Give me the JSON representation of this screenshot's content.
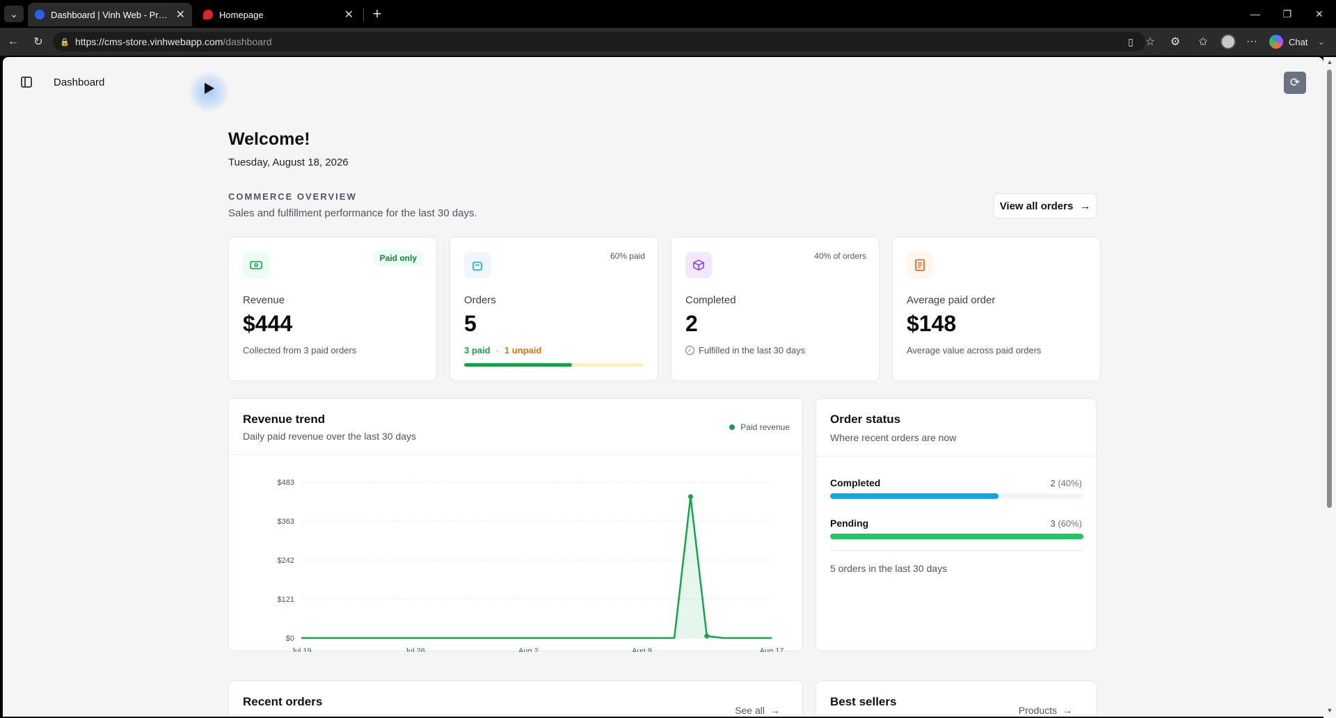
{
  "browser": {
    "tabs": [
      {
        "title": "Dashboard | Vinh Web - Professional",
        "active": true,
        "favicon_color": "#2563eb"
      },
      {
        "title": "Homepage",
        "active": false,
        "favicon_color": "#dc2626"
      }
    ],
    "url_host": "https://cms-store.vinhwebapp.com",
    "url_path": "/dashboard",
    "chat_label": "Chat"
  },
  "header": {
    "breadcrumb": "Dashboard"
  },
  "welcome": {
    "title": "Welcome!",
    "date": "Tuesday, August 18, 2026"
  },
  "overview": {
    "overline": "COMMERCE OVERVIEW",
    "description": "Sales and fulfillment performance for the last 30 days.",
    "view_all_label": "View all orders"
  },
  "kpis": {
    "revenue": {
      "label": "Revenue",
      "value": "$444",
      "badge": "Paid only",
      "sub": "Collected from 3 paid orders",
      "icon": "cash-icon",
      "icon_bg": "#ecfdf3",
      "icon_color": "#16a34a"
    },
    "orders": {
      "label": "Orders",
      "value": "5",
      "badge": "60% paid",
      "paid": "3 paid",
      "unpaid": "1 unpaid",
      "paid_fraction": 0.6,
      "icon": "shopping-bag-icon",
      "icon_bg": "#eff6ff",
      "icon_color": "#0ea5e9"
    },
    "completed": {
      "label": "Completed",
      "value": "2",
      "badge": "40% of orders",
      "sub": "Fulfilled in the last 30 days",
      "icon": "package-icon",
      "icon_bg": "#f3e8ff",
      "icon_color": "#7c3aed"
    },
    "average": {
      "label": "Average paid order",
      "value": "$148",
      "sub": "Average value across paid orders",
      "icon": "receipt-icon",
      "icon_bg": "#fff7ed",
      "icon_color": "#ea580c"
    }
  },
  "trend": {
    "title": "Revenue trend",
    "subtitle": "Daily paid revenue over the last 30 days",
    "legend": "Paid revenue"
  },
  "chart_data": {
    "type": "area",
    "title": "Revenue trend",
    "x": [
      "Jul 19",
      "Jul 20",
      "Jul 21",
      "Jul 22",
      "Jul 23",
      "Jul 24",
      "Jul 25",
      "Jul 26",
      "Jul 27",
      "Jul 28",
      "Jul 29",
      "Jul 30",
      "Jul 31",
      "Aug 1",
      "Aug 2",
      "Aug 3",
      "Aug 4",
      "Aug 5",
      "Aug 6",
      "Aug 7",
      "Aug 8",
      "Aug 9",
      "Aug 10",
      "Aug 11",
      "Aug 12",
      "Aug 13",
      "Aug 14",
      "Aug 15",
      "Aug 16",
      "Aug 17"
    ],
    "series": [
      {
        "name": "Paid revenue",
        "color": "#16a34a",
        "values": [
          0,
          0,
          0,
          0,
          0,
          0,
          0,
          0,
          0,
          0,
          0,
          0,
          0,
          0,
          0,
          0,
          0,
          0,
          0,
          0,
          0,
          0,
          0,
          0,
          438,
          6,
          0,
          0,
          0,
          0
        ]
      }
    ],
    "x_tick_labels": [
      "Jul 19",
      "Jul 26",
      "Aug 2",
      "Aug 9",
      "Aug 17"
    ],
    "y_tick_labels": [
      "$0",
      "$121",
      "$242",
      "$363",
      "$483"
    ],
    "ylim": [
      0,
      483
    ],
    "grid": true,
    "legend_placement": "top-right"
  },
  "status": {
    "title": "Order status",
    "subtitle": "Where recent orders are now",
    "rows": [
      {
        "label": "Completed",
        "count": "2",
        "pct": "(40%)",
        "fraction": 0.665,
        "color": "#0ea5e9"
      },
      {
        "label": "Pending",
        "count": "3",
        "pct": "(60%)",
        "fraction": 1.0,
        "color": "#22c55e"
      }
    ],
    "footer": "5 orders in the last 30 days"
  },
  "recent": {
    "title": "Recent orders",
    "link": "See all"
  },
  "best": {
    "title": "Best sellers",
    "link": "Products"
  }
}
